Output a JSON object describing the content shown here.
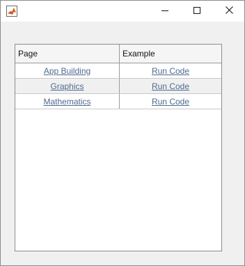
{
  "window": {
    "icons": {
      "app": "matlab-logo-icon",
      "minimize": "minimize-icon",
      "maximize": "maximize-icon",
      "close": "close-icon"
    }
  },
  "table": {
    "columns": [
      "Page",
      "Example"
    ],
    "rows": [
      {
        "page": "App Building",
        "example": "Run Code"
      },
      {
        "page": "Graphics",
        "example": "Run Code"
      },
      {
        "page": "Mathematics",
        "example": "Run Code"
      }
    ]
  },
  "colors": {
    "link": "#4d6a8e",
    "row_alt": "#f0f0f0",
    "header_bg": "#f5f5f5"
  }
}
